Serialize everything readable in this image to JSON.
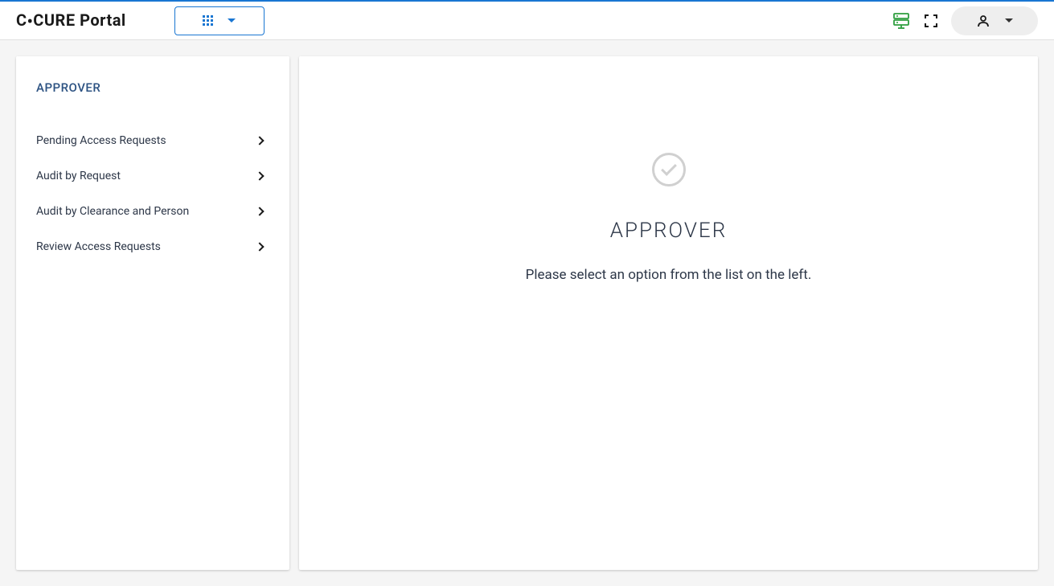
{
  "header": {
    "logo_pre": "C",
    "logo_dot": "•",
    "logo_post": "CURE Portal"
  },
  "sidebar": {
    "title": "APPROVER",
    "items": [
      {
        "label": "Pending Access Requests"
      },
      {
        "label": "Audit by Request"
      },
      {
        "label": "Audit by Clearance and Person"
      },
      {
        "label": "Review Access Requests"
      }
    ]
  },
  "main": {
    "title": "APPROVER",
    "message": "Please select an option from the list on the left."
  }
}
